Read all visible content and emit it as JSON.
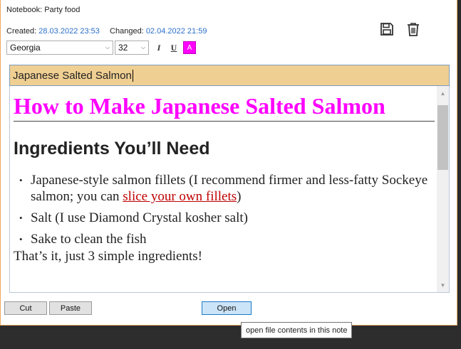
{
  "notebook": {
    "label": "Notebook: Party food"
  },
  "meta": {
    "created_label": "Created:",
    "created_value": "28.03.2022 23:53",
    "changed_label": "Changed:",
    "changed_value": "02.04.2022 21:59"
  },
  "toolbar": {
    "font_family": "Georgia",
    "font_size": "32",
    "italic": "I",
    "underline": "U",
    "color_icon": "A",
    "text_color": "#ff00ff",
    "icons": [
      "save-icon",
      "trash-icon"
    ]
  },
  "note": {
    "title": "Japanese Salted Salmon",
    "heading": "How to Make Japanese Salted Salmon",
    "subheading": "Ingredients You’ll Need",
    "items": [
      {
        "text": "Japanese-style salmon fillets (I recommend firmer and less-fatty Sockeye salmon; you can ",
        "link": "slice your own fillets",
        "after": ")"
      },
      {
        "text": "Salt (I use Diamond Crystal kosher salt)"
      },
      {
        "text": "Sake to clean the fish"
      }
    ],
    "footer_text": "That’s it, just 3 simple ingredients!"
  },
  "buttons": {
    "cut": "Cut",
    "paste": "Paste",
    "open": "Open"
  },
  "tooltip": {
    "text": "open file contents in this note"
  },
  "colors": {
    "accent_border": "#f0a860",
    "title_bg": "#f0cf92",
    "heading": "#ff00ff",
    "link": "#c00000",
    "date": "#2a6fc9"
  }
}
